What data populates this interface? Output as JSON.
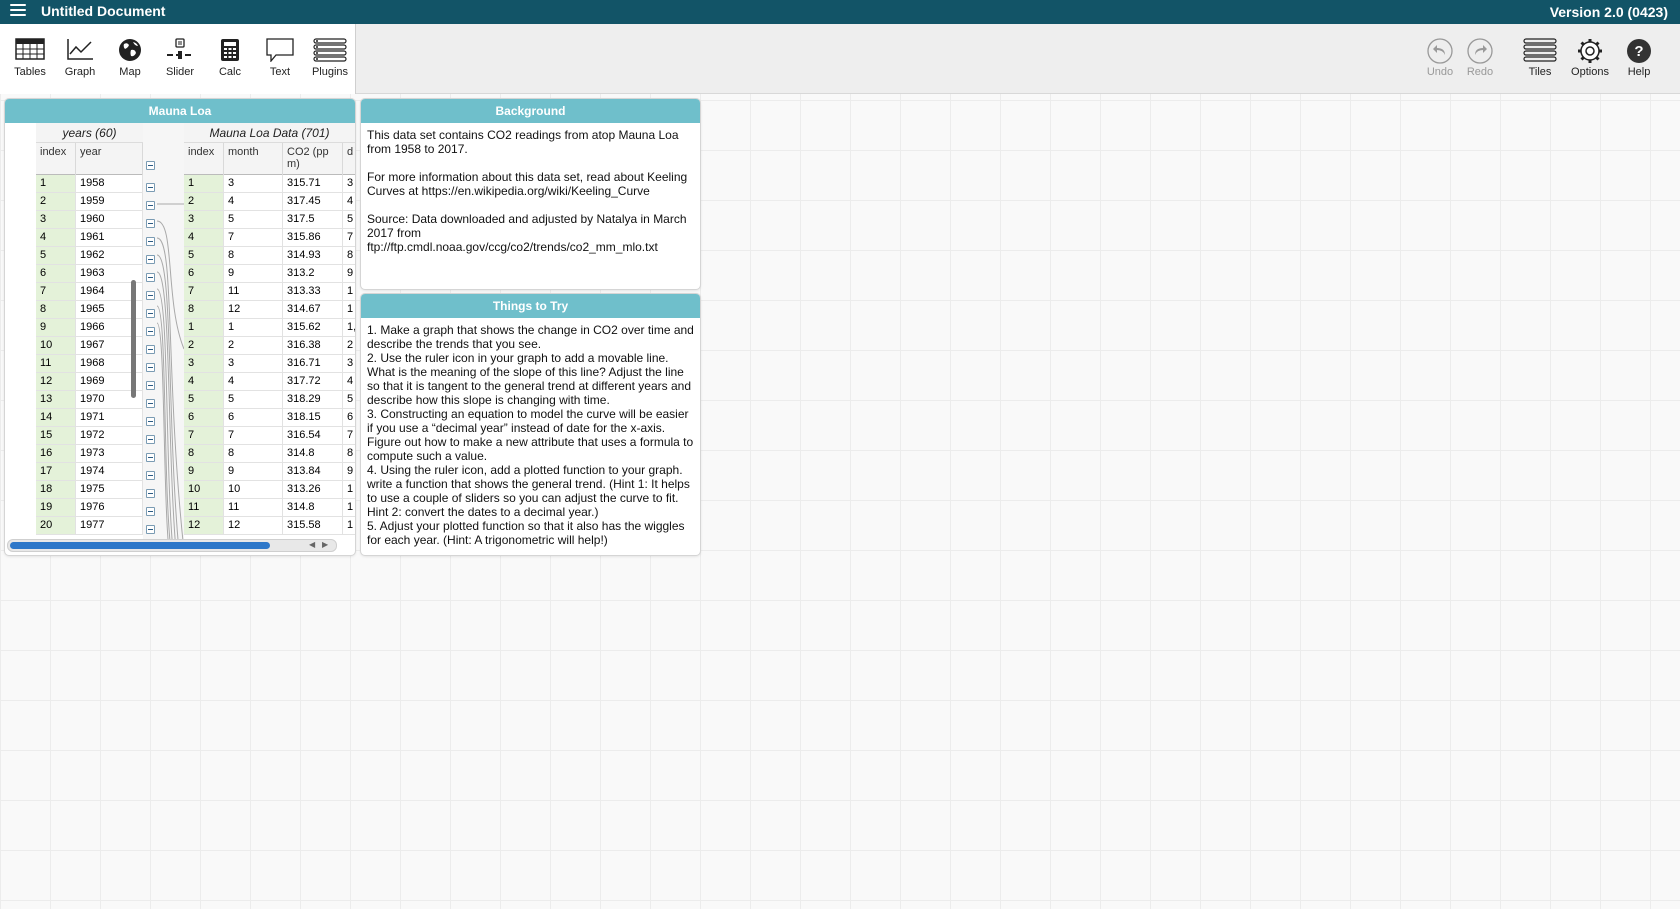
{
  "topbar": {
    "title": "Untitled Document",
    "version": "Version 2.0 (0423)"
  },
  "toolbar": {
    "left": [
      {
        "name": "tables",
        "label": "Tables",
        "icon": "table-icon"
      },
      {
        "name": "graph",
        "label": "Graph",
        "icon": "graph-icon"
      },
      {
        "name": "map",
        "label": "Map",
        "icon": "globe-icon"
      },
      {
        "name": "slider",
        "label": "Slider",
        "icon": "slider-icon"
      },
      {
        "name": "calc",
        "label": "Calc",
        "icon": "calculator-icon"
      },
      {
        "name": "text",
        "label": "Text",
        "icon": "text-icon"
      },
      {
        "name": "plugins",
        "label": "Plugins",
        "icon": "plugins-icon"
      }
    ],
    "right": [
      {
        "name": "undo",
        "label": "Undo",
        "icon": "undo-icon",
        "disabled": true
      },
      {
        "name": "redo",
        "label": "Redo",
        "icon": "redo-icon",
        "disabled": true
      },
      {
        "name": "tiles",
        "label": "Tiles",
        "icon": "tiles-icon"
      },
      {
        "name": "options",
        "label": "Options",
        "icon": "gear-icon"
      },
      {
        "name": "help",
        "label": "Help",
        "icon": "help-icon"
      }
    ]
  },
  "case_table": {
    "title": "Mauna Loa",
    "parent": {
      "name": "years (60)",
      "headers": [
        "index",
        "year"
      ],
      "rows": [
        [
          "1",
          "1958"
        ],
        [
          "2",
          "1959"
        ],
        [
          "3",
          "1960"
        ],
        [
          "4",
          "1961"
        ],
        [
          "5",
          "1962"
        ],
        [
          "6",
          "1963"
        ],
        [
          "7",
          "1964"
        ],
        [
          "8",
          "1965"
        ],
        [
          "9",
          "1966"
        ],
        [
          "10",
          "1967"
        ],
        [
          "11",
          "1968"
        ],
        [
          "12",
          "1969"
        ],
        [
          "13",
          "1970"
        ],
        [
          "14",
          "1971"
        ],
        [
          "15",
          "1972"
        ],
        [
          "16",
          "1973"
        ],
        [
          "17",
          "1974"
        ],
        [
          "18",
          "1975"
        ],
        [
          "19",
          "1976"
        ],
        [
          "20",
          "1977"
        ]
      ]
    },
    "child": {
      "name": "Mauna Loa Data (701)",
      "headers": [
        "index",
        "month",
        "CO2 (pp m)",
        "d"
      ],
      "rows": [
        [
          "1",
          "3",
          "315.71",
          "3"
        ],
        [
          "2",
          "4",
          "317.45",
          "4"
        ],
        [
          "3",
          "5",
          "317.5",
          "5"
        ],
        [
          "4",
          "7",
          "315.86",
          "7"
        ],
        [
          "5",
          "8",
          "314.93",
          "8"
        ],
        [
          "6",
          "9",
          "313.2",
          "9"
        ],
        [
          "7",
          "11",
          "313.33",
          "1"
        ],
        [
          "8",
          "12",
          "314.67",
          "1"
        ],
        [
          "1",
          "1",
          "315.62",
          "1,"
        ],
        [
          "2",
          "2",
          "316.38",
          "2"
        ],
        [
          "3",
          "3",
          "316.71",
          "3"
        ],
        [
          "4",
          "4",
          "317.72",
          "4"
        ],
        [
          "5",
          "5",
          "318.29",
          "5"
        ],
        [
          "6",
          "6",
          "318.15",
          "6"
        ],
        [
          "7",
          "7",
          "316.54",
          "7"
        ],
        [
          "8",
          "8",
          "314.8",
          "8"
        ],
        [
          "9",
          "9",
          "313.84",
          "9"
        ],
        [
          "10",
          "10",
          "313.26",
          "1"
        ],
        [
          "11",
          "11",
          "314.8",
          "1"
        ],
        [
          "12",
          "12",
          "315.58",
          "1"
        ]
      ]
    }
  },
  "background_tile": {
    "title": "Background",
    "text": "This data set contains CO2 readings from atop Mauna Loa from 1958 to 2017.\n\nFor more information about this data set, read about Keeling Curves at https://en.wikipedia.org/wiki/Keeling_Curve\n\nSource: Data downloaded and adjusted by Natalya in March 2017 from ftp://ftp.cmdl.noaa.gov/ccg/co2/trends/co2_mm_mlo.txt"
  },
  "try_tile": {
    "title": "Things to Try",
    "text": "1. Make a graph that shows the change in CO2 over time and describe the trends that you see.\n2. Use the ruler icon in your graph to add a movable line. What is the meaning of the slope of this line? Adjust the line so that it is tangent to the general trend at different years and describe how this slope is changing with time.\n3. Constructing an equation to model the curve will be easier if you use a “decimal year” instead of date for the x-axis. Figure out how to make a new attribute that uses a formula to compute such a value.\n4. Using the ruler icon, add a plotted function to your graph. write a function that shows the general trend. (Hint 1: It helps to use a couple of sliders so you can adjust the curve to fit. Hint 2: convert the dates to a decimal year.)\n5. Adjust your plotted function so that it also has the wiggles for each year. (Hint: A trigonometric will help!)"
  }
}
